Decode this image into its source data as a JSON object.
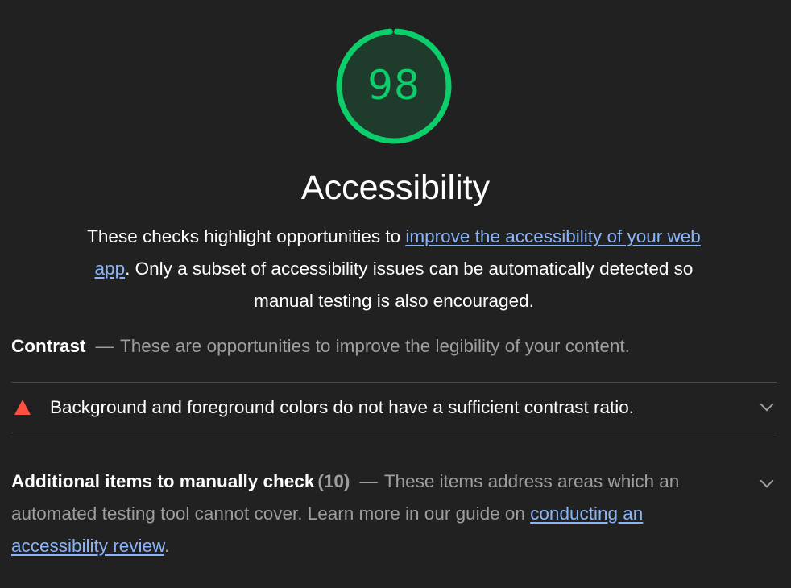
{
  "score": {
    "value": "98",
    "fraction": 0.98,
    "color": "#0cce6b",
    "track_color": "#1e3b2c"
  },
  "category": {
    "title": "Accessibility",
    "description_before": "These checks highlight opportunities to ",
    "description_link": "improve the accessibility of your web app",
    "description_after": ". Only a subset of accessibility issues can be automatically detected so manual testing is also encouraged."
  },
  "contrast_group": {
    "title": "Contrast",
    "separator": "—",
    "description": "These are opportunities to improve the legibility of your content."
  },
  "audit": {
    "icon": "fail-triangle-icon",
    "icon_color": "#ff4e42",
    "title": "Background and foreground colors do not have a sufficient contrast ratio."
  },
  "manual_group": {
    "title": "Additional items to manually check",
    "count": "(10)",
    "separator": "—",
    "description_before": "These items address areas which an automated testing tool cannot cover. Learn more in our guide on ",
    "description_link": "conducting an accessibility review",
    "description_after": "."
  },
  "colors": {
    "background": "#212121",
    "link": "#8ab4f8",
    "muted_text": "#9e9e9e"
  }
}
